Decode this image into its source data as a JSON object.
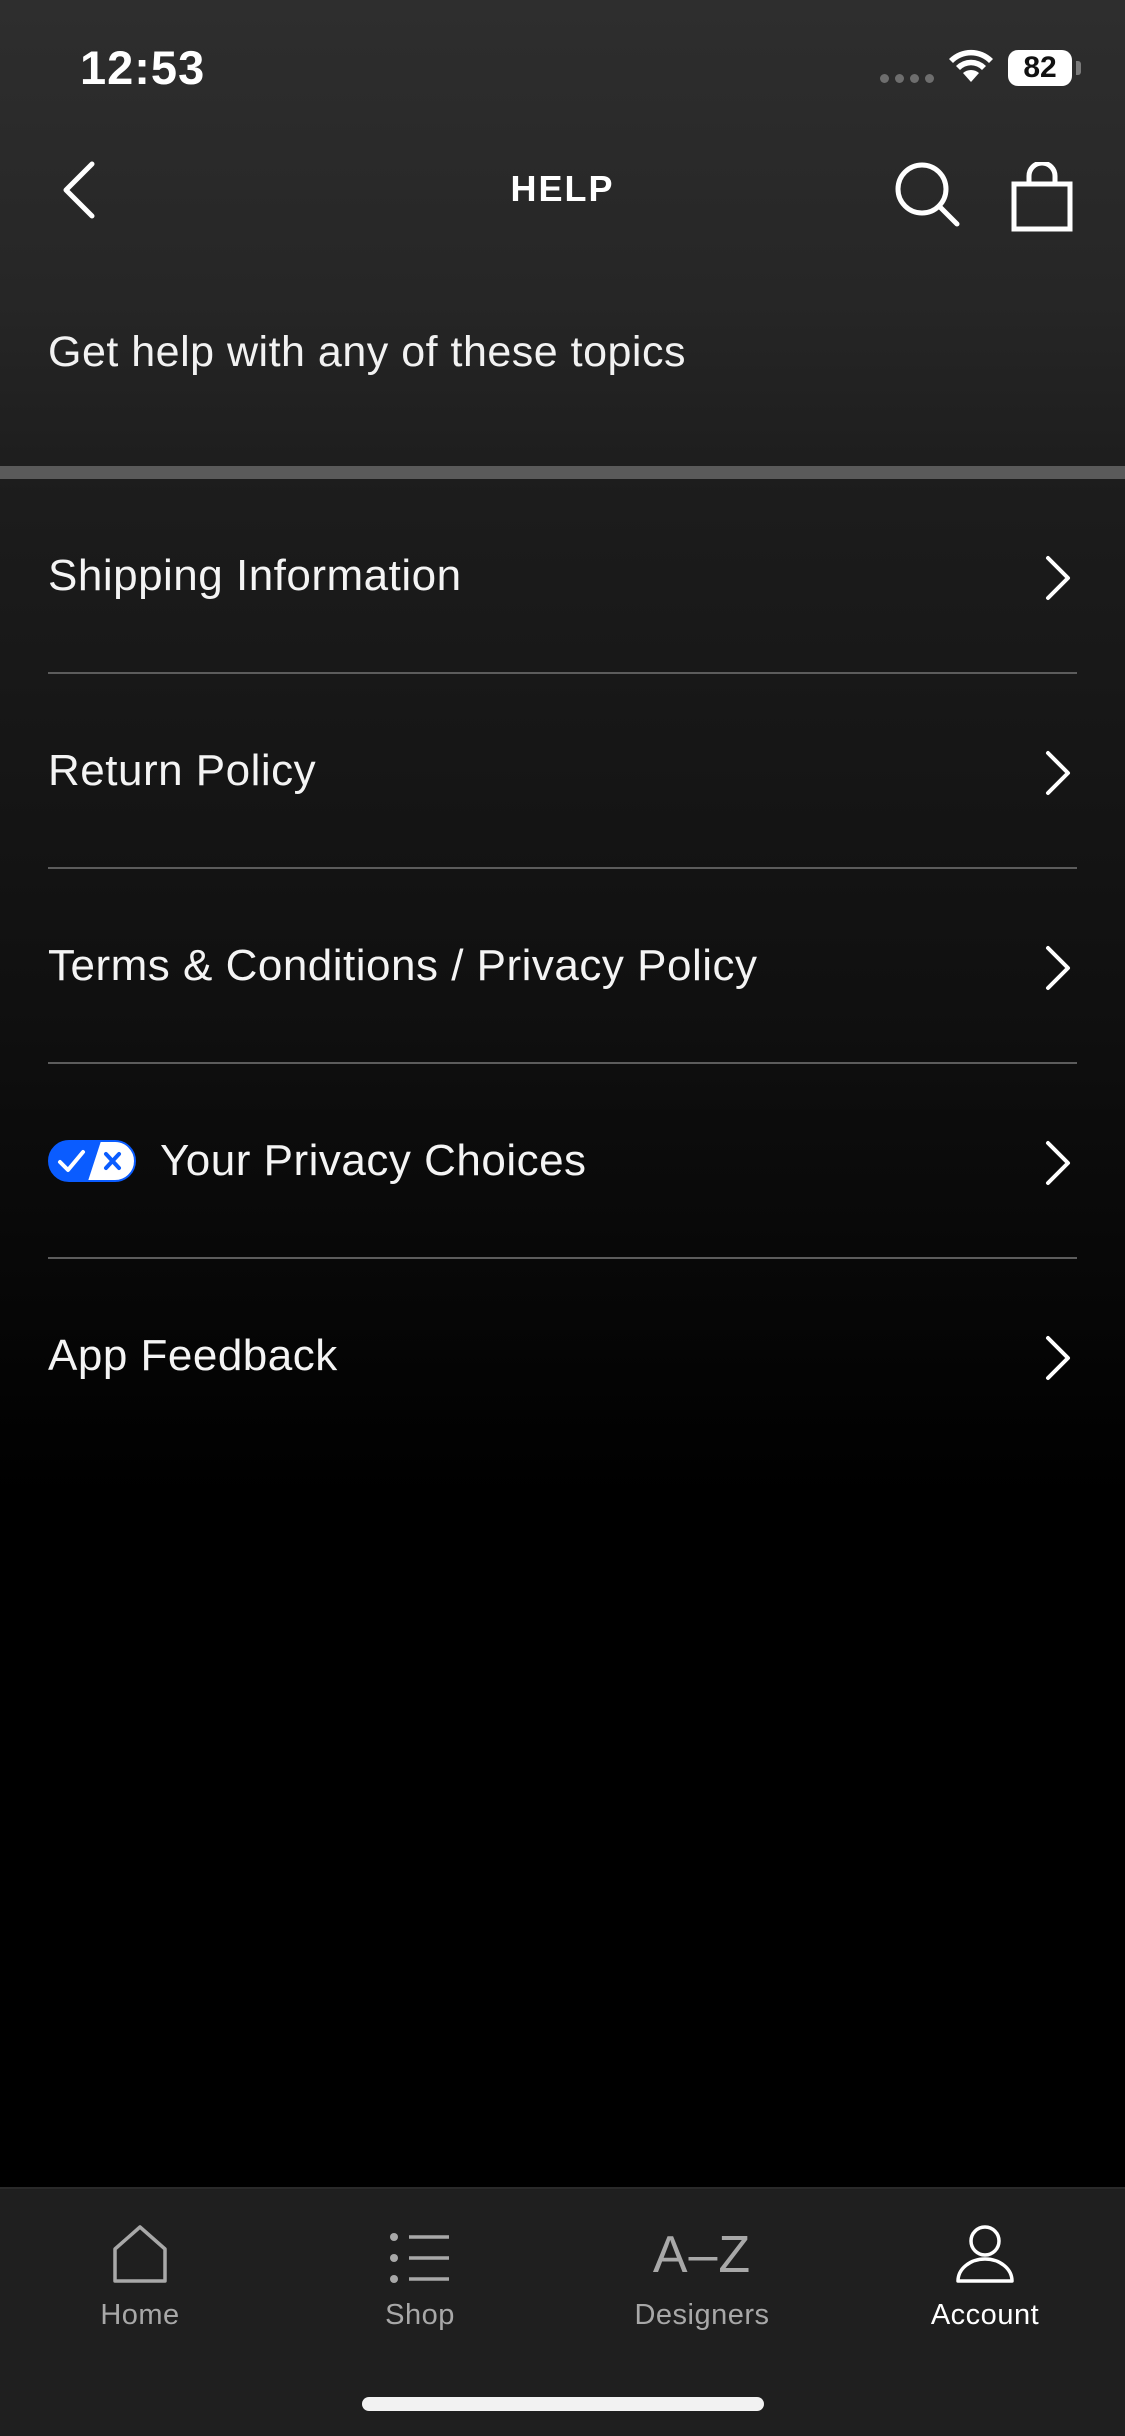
{
  "status_bar": {
    "time": "12:53",
    "battery": "82"
  },
  "nav": {
    "title": "HELP",
    "back_icon": "chevron-left-icon",
    "search_icon": "search-icon",
    "bag_icon": "shopping-bag-icon"
  },
  "intro": {
    "text": "Get help with any of these topics"
  },
  "help_items": [
    {
      "label": "Shipping Information"
    },
    {
      "label": "Return Policy"
    },
    {
      "label": "Terms & Conditions / Privacy Policy"
    },
    {
      "label": "Your Privacy Choices",
      "icon": "privacy-toggle-icon"
    },
    {
      "label": "App Feedback"
    }
  ],
  "tab_bar": {
    "tabs": [
      {
        "label": "Home",
        "icon": "home-icon",
        "active": false
      },
      {
        "label": "Shop",
        "icon": "list-icon",
        "active": false
      },
      {
        "label": "Designers",
        "glyph": "A–Z",
        "active": false
      },
      {
        "label": "Account",
        "icon": "account-icon",
        "active": true
      }
    ]
  },
  "colors": {
    "background": "#000000",
    "tab_bar": "#1f1f1f",
    "divider": "#5c5c5c",
    "privacy_blue": "#0a5cff",
    "inactive_tab": "#a8a8a8",
    "active_tab": "#ffffff"
  }
}
